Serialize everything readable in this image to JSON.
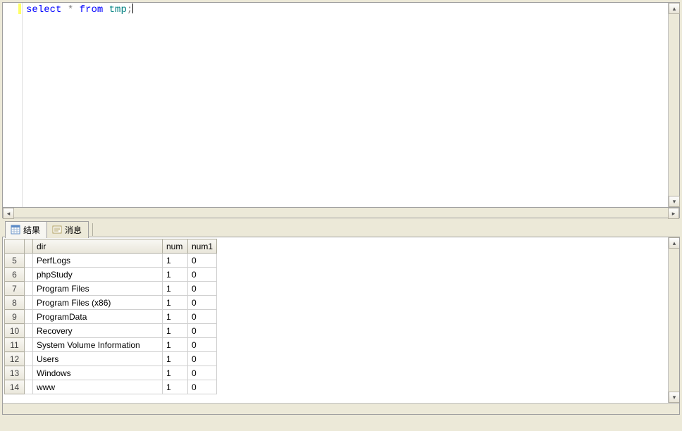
{
  "editor": {
    "sql_keyword_select": "select",
    "sql_star": "*",
    "sql_keyword_from": "from",
    "sql_ident": "tmp",
    "sql_terminator": ";"
  },
  "tabs": {
    "results": "结果",
    "messages": "消息"
  },
  "grid": {
    "columns": {
      "blank": "",
      "sel": "",
      "dir": "dir",
      "num": "num",
      "num1": "num1"
    },
    "rows": [
      {
        "n": "5",
        "dir": "PerfLogs",
        "num": "1",
        "num1": "0"
      },
      {
        "n": "6",
        "dir": "phpStudy",
        "num": "1",
        "num1": "0"
      },
      {
        "n": "7",
        "dir": "Program Files",
        "num": "1",
        "num1": "0"
      },
      {
        "n": "8",
        "dir": "Program Files (x86)",
        "num": "1",
        "num1": "0"
      },
      {
        "n": "9",
        "dir": "ProgramData",
        "num": "1",
        "num1": "0"
      },
      {
        "n": "10",
        "dir": "Recovery",
        "num": "1",
        "num1": "0"
      },
      {
        "n": "11",
        "dir": "System Volume Information",
        "num": "1",
        "num1": "0"
      },
      {
        "n": "12",
        "dir": "Users",
        "num": "1",
        "num1": "0"
      },
      {
        "n": "13",
        "dir": "Windows",
        "num": "1",
        "num1": "0"
      },
      {
        "n": "14",
        "dir": "www",
        "num": "1",
        "num1": "0"
      }
    ]
  }
}
